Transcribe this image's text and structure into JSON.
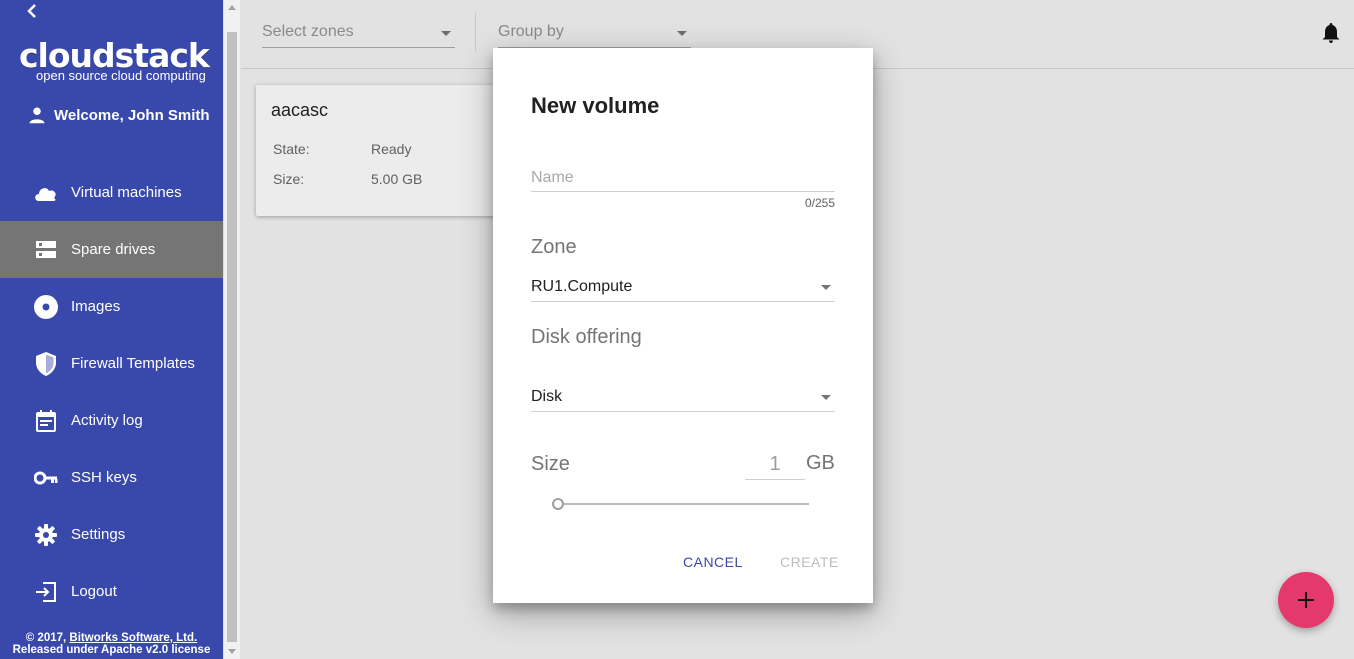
{
  "sidebar": {
    "logo_main": "cloudstack",
    "logo_sub": "open source cloud computing",
    "welcome": "Welcome, John Smith",
    "items": [
      {
        "label": "Virtual machines",
        "icon": "cloud-icon"
      },
      {
        "label": "Spare drives",
        "icon": "storage-icon",
        "active": true
      },
      {
        "label": "Images",
        "icon": "disc-icon"
      },
      {
        "label": "Firewall Templates",
        "icon": "shield-icon"
      },
      {
        "label": "Activity log",
        "icon": "calendar-icon"
      },
      {
        "label": "SSH keys",
        "icon": "key-icon"
      },
      {
        "label": "Settings",
        "icon": "gear-icon"
      },
      {
        "label": "Logout",
        "icon": "logout-icon"
      }
    ],
    "footer_prefix": "© 2017, ",
    "footer_company": "Bitworks Software, Ltd.",
    "footer_license": "Released under Apache v2.0 license"
  },
  "topbar": {
    "zones_placeholder": "Select zones",
    "group_by_placeholder": "Group by"
  },
  "card": {
    "title": "aacasc",
    "state_label": "State:",
    "state_value": "Ready",
    "size_label": "Size:",
    "size_value": "5.00 GB"
  },
  "dialog": {
    "title": "New volume",
    "name_placeholder": "Name",
    "name_value": "",
    "name_counter": "0/255",
    "zone_label": "Zone",
    "zone_value": "RU1.Compute",
    "disk_offering_label": "Disk offering",
    "disk_offering_value": "Disk",
    "size_label": "Size",
    "size_value": "1",
    "size_unit": "GB",
    "cancel_label": "CANCEL",
    "create_label": "CREATE"
  },
  "colors": {
    "sidebar": "#3949ab",
    "active_item": "#757575",
    "accent": "#3949ab",
    "fab": "#e5396e"
  },
  "fab": {
    "icon": "plus-icon"
  }
}
